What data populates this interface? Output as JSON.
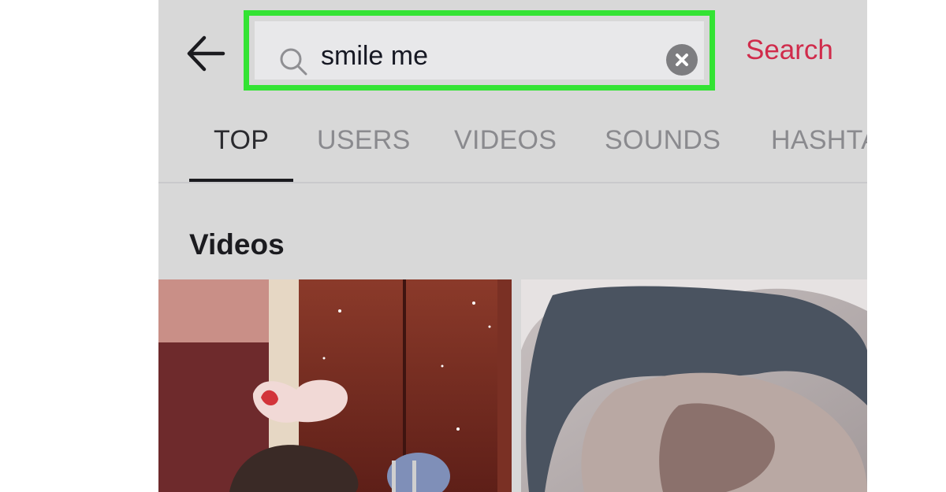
{
  "search": {
    "query": "smile me",
    "action_label": "Search"
  },
  "tabs": [
    {
      "label": "TOP",
      "active": true
    },
    {
      "label": "USERS",
      "active": false
    },
    {
      "label": "VIDEOS",
      "active": false
    },
    {
      "label": "SOUNDS",
      "active": false
    },
    {
      "label": "HASHTAGS",
      "active": false
    }
  ],
  "section": {
    "title": "Videos"
  },
  "colors": {
    "highlight": "#33e333",
    "accent": "#d02b4b",
    "background": "#d8d8d8"
  },
  "icons": [
    "back-arrow-icon",
    "search-icon",
    "clear-icon"
  ]
}
